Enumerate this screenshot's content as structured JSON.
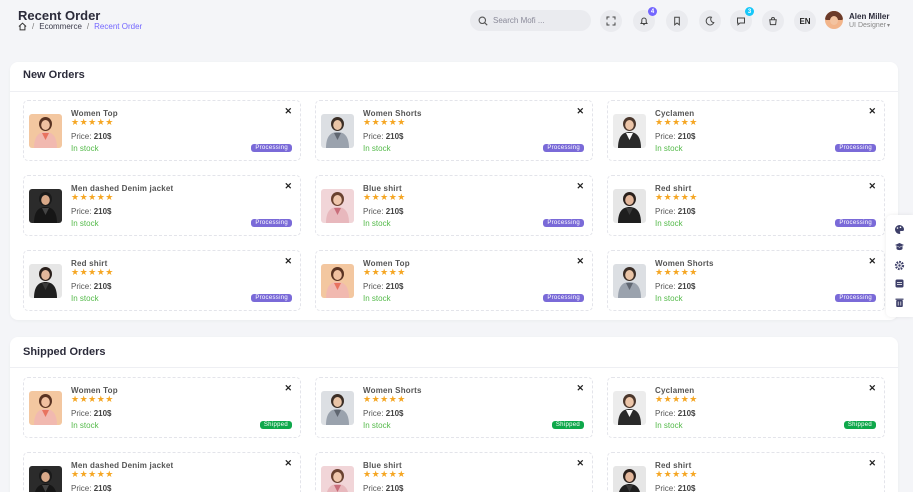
{
  "header": {
    "title": "Recent Order",
    "breadcrumb": [
      "Ecommerce",
      "Recent Order"
    ],
    "breadcrumb_sep": "/",
    "search_placeholder": "Search Mofi ...",
    "notification_count": "4",
    "cart_count": "3",
    "language": "EN",
    "user_name": "Alen Miller",
    "user_role": "UI Designer"
  },
  "colors": {
    "accent": "#7366ff",
    "processing": "#7a6ad8",
    "shipped": "#0fa84b",
    "stock": "#54ba4a",
    "star": "#f5a623",
    "notif_badge": "#7366ff",
    "cart_badge": "#16c7f9"
  },
  "icons": {
    "fullscreen": "expand-icon",
    "notification": "bell-icon",
    "bookmark": "bookmark-icon",
    "theme": "moon-icon",
    "messages": "message-icon",
    "cart": "bag-icon",
    "floating": [
      "palette-icon",
      "cap-icon",
      "gear-icon",
      "page-icon",
      "trash-icon"
    ]
  },
  "new_orders": {
    "title": "New Orders",
    "items": [
      {
        "name": "Women Top",
        "price_label": "Price:",
        "price": "210$",
        "stock": "In stock",
        "status": "Processing",
        "rating": 5,
        "stars": "★★★★★",
        "close": "✕",
        "image": "woman-orange"
      },
      {
        "name": "Women Shorts",
        "price_label": "Price:",
        "price": "210$",
        "stock": "In stock",
        "status": "Processing",
        "rating": 5,
        "stars": "★★★★★",
        "close": "✕",
        "image": "man-grey"
      },
      {
        "name": "Cyclamen",
        "price_label": "Price:",
        "price": "210$",
        "stock": "In stock",
        "status": "Processing",
        "rating": 5,
        "stars": "★★★★★",
        "close": "✕",
        "image": "woman-black-white"
      },
      {
        "name": "Men dashed Denim jacket",
        "price_label": "Price:",
        "price": "210$",
        "stock": "In stock",
        "status": "Processing",
        "rating": 5,
        "stars": "★★★★★",
        "close": "✕",
        "image": "man-dark"
      },
      {
        "name": "Blue shirt",
        "price_label": "Price:",
        "price": "210$",
        "stock": "In stock",
        "status": "Processing",
        "rating": 5,
        "stars": "★★★★★",
        "close": "✕",
        "image": "woman-pink"
      },
      {
        "name": "Red shirt",
        "price_label": "Price:",
        "price": "210$",
        "stock": "In stock",
        "status": "Processing",
        "rating": 5,
        "stars": "★★★★★",
        "close": "✕",
        "image": "woman-dark"
      },
      {
        "name": "Red shirt",
        "price_label": "Price:",
        "price": "210$",
        "stock": "In stock",
        "status": "Processing",
        "rating": 5,
        "stars": "★★★★★",
        "close": "✕",
        "image": "woman-dark"
      },
      {
        "name": "Women Top",
        "price_label": "Price:",
        "price": "210$",
        "stock": "In stock",
        "status": "Processing",
        "rating": 5,
        "stars": "★★★★★",
        "close": "✕",
        "image": "woman-orange"
      },
      {
        "name": "Women Shorts",
        "price_label": "Price:",
        "price": "210$",
        "stock": "In stock",
        "status": "Processing",
        "rating": 5,
        "stars": "★★★★★",
        "close": "✕",
        "image": "man-grey"
      }
    ]
  },
  "shipped_orders": {
    "title": "Shipped Orders",
    "items": [
      {
        "name": "Women Top",
        "price_label": "Price:",
        "price": "210$",
        "stock": "In stock",
        "status": "Shipped",
        "rating": 5,
        "stars": "★★★★★",
        "close": "✕",
        "image": "woman-orange"
      },
      {
        "name": "Women Shorts",
        "price_label": "Price:",
        "price": "210$",
        "stock": "In stock",
        "status": "Shipped",
        "rating": 5,
        "stars": "★★★★★",
        "close": "✕",
        "image": "man-grey"
      },
      {
        "name": "Cyclamen",
        "price_label": "Price:",
        "price": "210$",
        "stock": "In stock",
        "status": "Shipped",
        "rating": 5,
        "stars": "★★★★★",
        "close": "✕",
        "image": "woman-black-white"
      },
      {
        "name": "Men dashed Denim jacket",
        "price_label": "Price:",
        "price": "210$",
        "stock": "",
        "status": "",
        "rating": 5,
        "stars": "★★★★★",
        "close": "✕",
        "image": "man-dark"
      },
      {
        "name": "Blue shirt",
        "price_label": "Price:",
        "price": "210$",
        "stock": "",
        "status": "",
        "rating": 5,
        "stars": "★★★★★",
        "close": "✕",
        "image": "woman-pink"
      },
      {
        "name": "Red shirt",
        "price_label": "Price:",
        "price": "210$",
        "stock": "",
        "status": "",
        "rating": 5,
        "stars": "★★★★★",
        "close": "✕",
        "image": "woman-dark"
      }
    ]
  }
}
